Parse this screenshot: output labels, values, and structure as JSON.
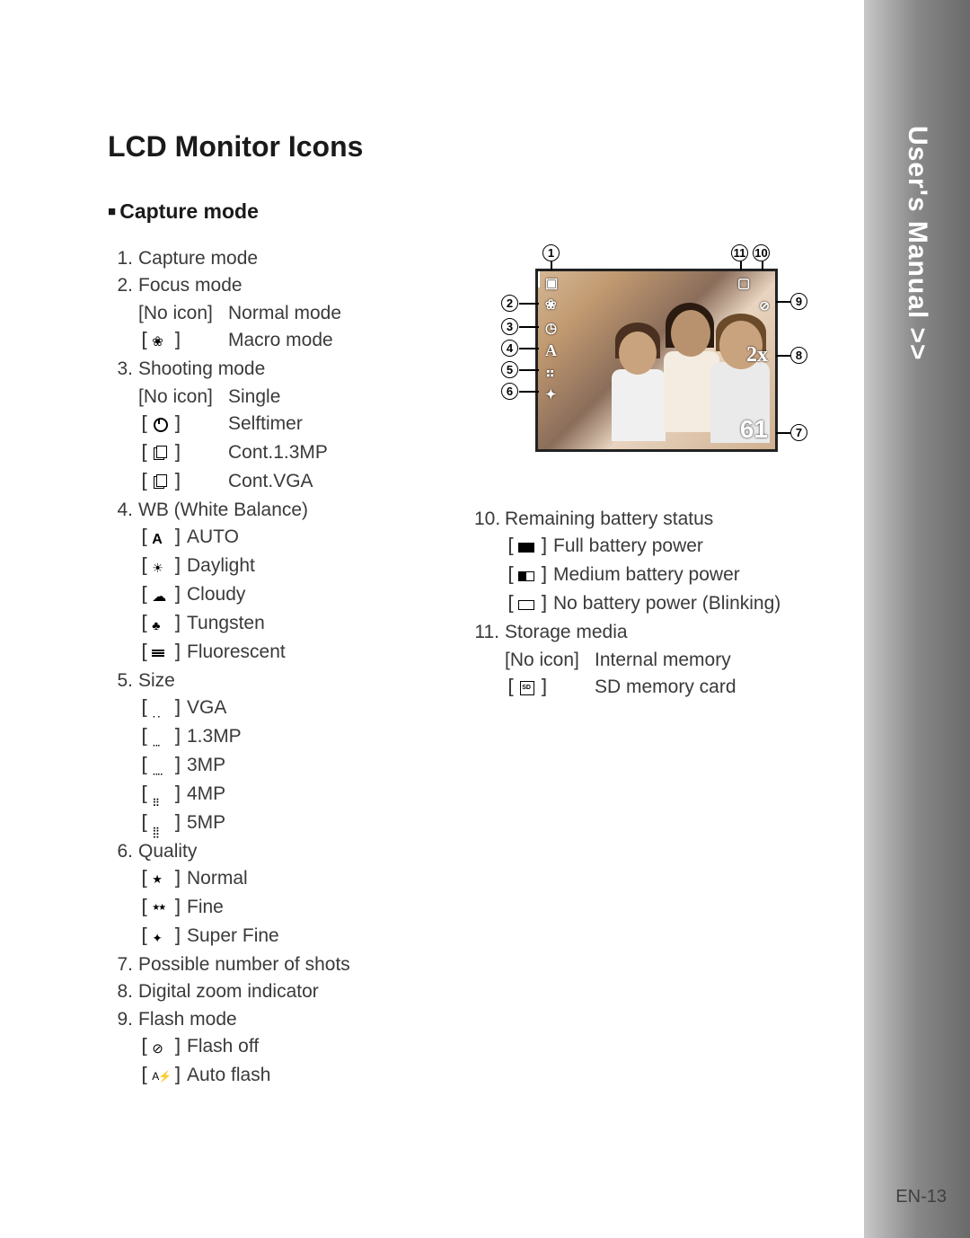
{
  "sidebar_title": "User's Manual >>",
  "page_number": "EN-13",
  "heading": "LCD Monitor Icons",
  "subheading": "Capture mode",
  "diagram": {
    "zoom": "2x",
    "count": "61",
    "wb_icon": "A",
    "callouts": [
      "1",
      "2",
      "3",
      "4",
      "5",
      "6",
      "7",
      "8",
      "9",
      "10",
      "11"
    ]
  },
  "left": {
    "i1": {
      "num": "1.",
      "label": "Capture mode"
    },
    "i2": {
      "num": "2.",
      "label": "Focus mode",
      "a": {
        "icon": "[No icon]",
        "text": "Normal mode"
      },
      "b": {
        "text": "Macro mode"
      }
    },
    "i3": {
      "num": "3.",
      "label": "Shooting mode",
      "a": {
        "icon": "[No icon]",
        "text": "Single"
      },
      "b": {
        "text": "Selftimer"
      },
      "c": {
        "text": "Cont.1.3MP"
      },
      "d": {
        "text": "Cont.VGA"
      }
    },
    "i4": {
      "num": "4.",
      "label": "WB (White Balance)",
      "a": {
        "text": "AUTO"
      },
      "b": {
        "text": "Daylight"
      },
      "c": {
        "text": "Cloudy"
      },
      "d": {
        "text": "Tungsten"
      },
      "e": {
        "text": "Fluorescent"
      }
    },
    "i5": {
      "num": "5.",
      "label": "Size",
      "a": {
        "text": "VGA"
      },
      "b": {
        "text": "1.3MP"
      },
      "c": {
        "text": "3MP"
      },
      "d": {
        "text": "4MP"
      },
      "e": {
        "text": "5MP"
      }
    },
    "i6": {
      "num": "6.",
      "label": "Quality",
      "a": {
        "text": "Normal"
      },
      "b": {
        "text": "Fine"
      },
      "c": {
        "text": "Super Fine"
      }
    },
    "i7": {
      "num": "7.",
      "label": "Possible number of shots"
    },
    "i8": {
      "num": "8.",
      "label": "Digital zoom indicator"
    },
    "i9": {
      "num": "9.",
      "label": "Flash mode",
      "a": {
        "text": "Flash off"
      },
      "b": {
        "text": "Auto flash"
      }
    }
  },
  "right": {
    "i10": {
      "num": "10.",
      "label": "Remaining battery status",
      "a": {
        "text": "Full battery power"
      },
      "b": {
        "text": "Medium battery power"
      },
      "c": {
        "text": "No battery power (Blinking)"
      }
    },
    "i11": {
      "num": "11.",
      "label": "Storage media",
      "a": {
        "icon": "[No icon]",
        "text": "Internal memory"
      },
      "b": {
        "text": "SD memory card"
      }
    }
  }
}
